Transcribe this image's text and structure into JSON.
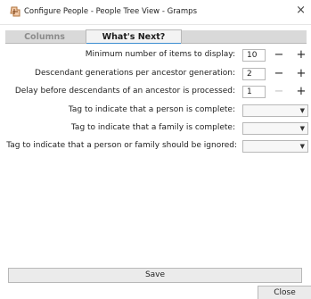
{
  "window": {
    "title": "Configure People - People Tree View - Gramps",
    "close_glyph": "×",
    "icon": "gramps-app-icon"
  },
  "tabs": [
    {
      "label": "Columns",
      "active": false
    },
    {
      "label": "What's Next?",
      "active": true
    }
  ],
  "settings": {
    "rows": [
      {
        "label": "Minimum number of items to display:",
        "value": "10",
        "minus_enabled": true
      },
      {
        "label": "Descendant generations per ancestor generation:",
        "value": "2",
        "minus_enabled": true
      },
      {
        "label": "Delay before descendants of an ancestor is processed:",
        "value": "1",
        "minus_enabled": false
      }
    ],
    "tags": [
      {
        "label": "Tag to indicate that a person is complete:",
        "value": ""
      },
      {
        "label": "Tag to indicate that a family is complete:",
        "value": ""
      },
      {
        "label": "Tag to indicate that a person or family should be ignored:",
        "value": ""
      }
    ],
    "minus_glyph": "−",
    "plus_glyph": "+",
    "dropdown_glyph": "▼"
  },
  "buttons": {
    "save": "Save",
    "close": "Close"
  },
  "colors": {
    "tab_underline": "#3b8ed0",
    "tab_strip": "#d9d9d9"
  }
}
